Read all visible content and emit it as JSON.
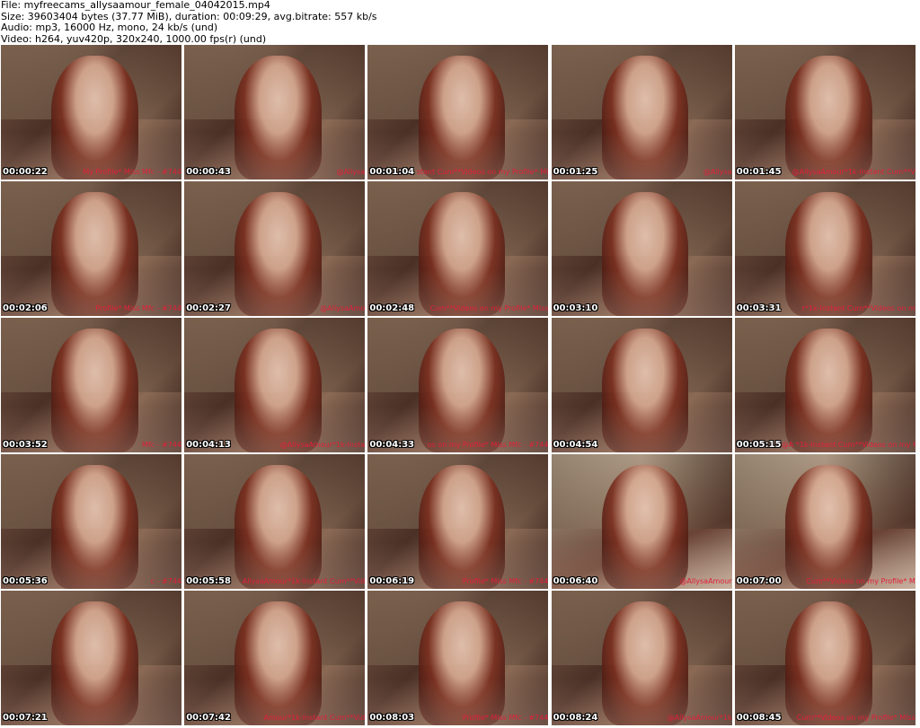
{
  "header": {
    "file": "File: myfreecams_allysaamour_female_04042015.mp4",
    "size": "Size: 39603404 bytes (37.77 MiB), duration: 00:09:29, avg.bitrate: 557 kb/s",
    "audio": "Audio: mp3, 16000 Hz, mono, 24 kb/s (und)",
    "video": "Video: h264, yuv420p, 320x240, 1000.00 fps(r) (und)"
  },
  "thumbnails": [
    {
      "time": "00:00:22",
      "ticker": "My Profile* Miss Mfc - #744"
    },
    {
      "time": "00:00:43",
      "ticker": "@Allysa"
    },
    {
      "time": "00:01:04",
      "ticker": "stant Cum**Videos on my Profile* Mi"
    },
    {
      "time": "00:01:25",
      "ticker": "@Allysa"
    },
    {
      "time": "00:01:45",
      "ticker": "@AllysaAmour*1k-Instant Cum**V"
    },
    {
      "time": "00:02:06",
      "ticker": "Profile* Miss Mfc - #744"
    },
    {
      "time": "00:02:27",
      "ticker": "@AllysaAmo"
    },
    {
      "time": "00:02:48",
      "ticker": "Cum**Videos on my Profile* Miss"
    },
    {
      "time": "00:03:10",
      "ticker": ""
    },
    {
      "time": "00:03:31",
      "ticker": "r*1k-Instant Cum**Videos on m"
    },
    {
      "time": "00:03:52",
      "ticker": "Mfc - #744"
    },
    {
      "time": "00:04:13",
      "ticker": "@AllysaAmour*1k-Insta"
    },
    {
      "time": "00:04:33",
      "ticker": "os on my Profile* Miss Mfc - #744"
    },
    {
      "time": "00:04:54",
      "ticker": ""
    },
    {
      "time": "00:05:15",
      "ticker": "@A *1k-Instant Cum**Videos on my Pr"
    },
    {
      "time": "00:05:36",
      "ticker": "c - #744"
    },
    {
      "time": "00:05:58",
      "ticker": "AllysaAmour*1k-Instant Cum**Vid"
    },
    {
      "time": "00:06:19",
      "ticker": "Profile* Miss Mfc - #744"
    },
    {
      "time": "00:06:40",
      "ticker": "@AllysaAmour"
    },
    {
      "time": "00:07:00",
      "ticker": "Cum**Videos on my Profile* M"
    },
    {
      "time": "00:07:21",
      "ticker": ""
    },
    {
      "time": "00:07:42",
      "ticker": "Amour*1k-Instant Cum**Vid"
    },
    {
      "time": "00:08:03",
      "ticker": "Profile* Miss Mfc - #744"
    },
    {
      "time": "00:08:24",
      "ticker": "@AllysaAmour*1k"
    },
    {
      "time": "00:08:45",
      "ticker": "Cum**Videos on my Profile* Miss"
    }
  ],
  "colors": {
    "background": "#ffffff",
    "timestamp": "#ffffff",
    "ticker": "#e0203a"
  }
}
